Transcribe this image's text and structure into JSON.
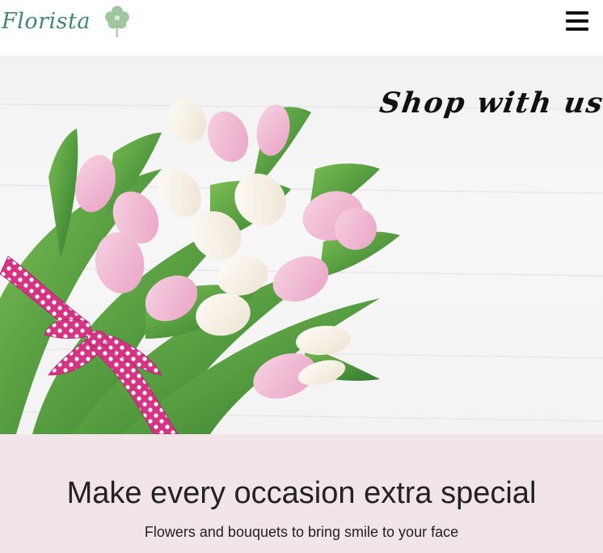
{
  "brand": {
    "name": "Florista",
    "logo_icon": "flower-icon",
    "logo_color": "#9fc8a1"
  },
  "navbar": {
    "menu_icon": "hamburger-menu-icon"
  },
  "hero": {
    "headline": "Shop with us",
    "image": "pink-and-white-tulip-bouquet-with-polka-dot-ribbon",
    "ribbon_color": "#d63384"
  },
  "tagline": {
    "title": "Make every occasion extra special",
    "subtitle": "Flowers and bouquets to bring smile to your face",
    "background": "#f1e5ea"
  },
  "colors": {
    "brand_text": "#3f8a6e",
    "tulip_pink": "#eeb6cf",
    "tulip_white": "#f6f0e6",
    "leaf_green": "#4f9a3c"
  }
}
